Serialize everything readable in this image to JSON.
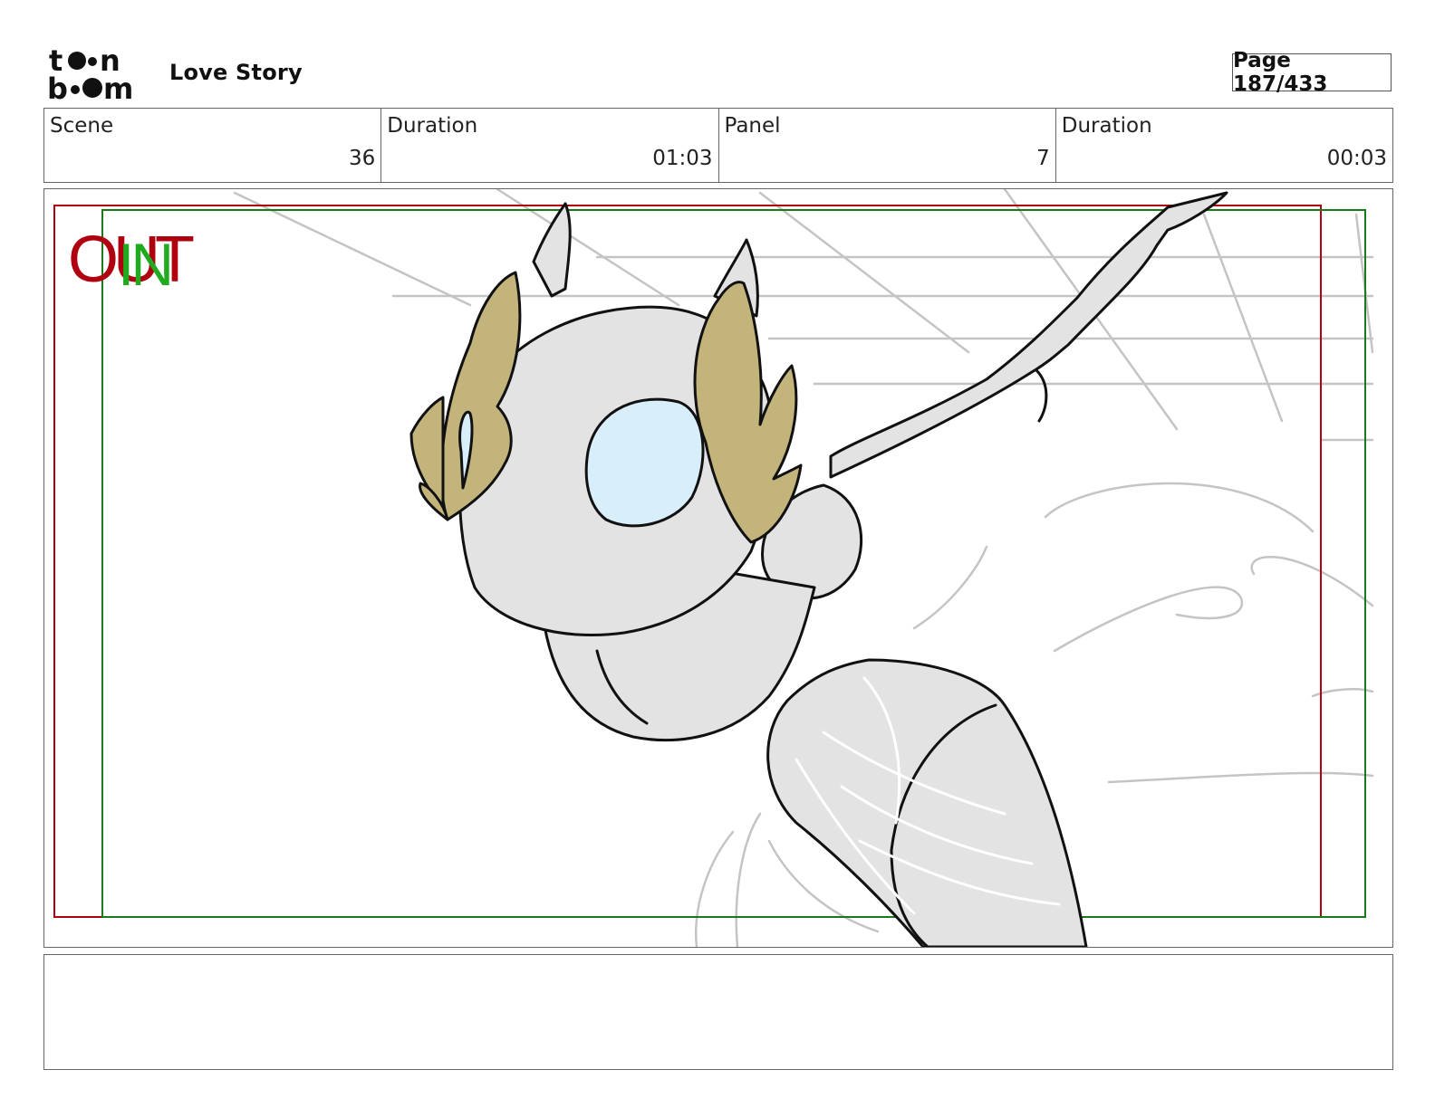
{
  "header": {
    "logo_text": "toonboom",
    "project_title": "Love Story",
    "page_label": "Page 187/433"
  },
  "info": {
    "scene_label": "Scene",
    "scene_value": "36",
    "scene_duration_label": "Duration",
    "scene_duration_value": "01:03",
    "panel_label": "Panel",
    "panel_value": "7",
    "panel_duration_label": "Duration",
    "panel_duration_value": "00:03"
  },
  "panel": {
    "out_label": "OUT",
    "in_label": "IN",
    "colors": {
      "out_frame": "#b00010",
      "in_frame": "#1a7a1a",
      "in_text": "#1faa1f",
      "body_fill": "#e3e3e3",
      "hair_fill": "#c3b47c",
      "eye_fill": "#d8eefb",
      "sketch_lines": "#bdbdbd"
    }
  },
  "notes": {
    "text": ""
  }
}
